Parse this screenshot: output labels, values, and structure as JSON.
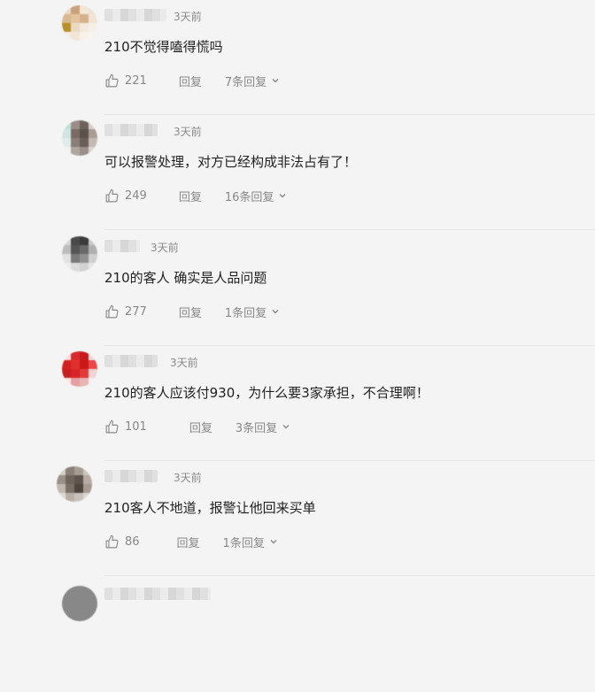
{
  "comments": [
    {
      "time": "3天前",
      "text": "210不觉得嗑得慌吗",
      "likes": "221",
      "reply_label": "回复",
      "replies": "7条回复",
      "avatar_colors": [
        "#e8d9c8",
        "#c9a27a",
        "#f2e6d6",
        "#efe3d3",
        "#d8b890",
        "#e4c49e",
        "#d6b08a",
        "#f0e4d4",
        "#b8902a",
        "#eadac4",
        "#f3e9dc",
        "#f6efe6",
        "#f5ede3",
        "#f1e5d6",
        "#f7f1e9",
        "#f9f5ef"
      ]
    },
    {
      "time": "3天前",
      "text": "可以报警处理，对方已经构成非法占有了！",
      "likes": "249",
      "reply_label": "回复",
      "replies": "16条回复",
      "avatar_colors": [
        "#bfe0da",
        "#9a8e88",
        "#6e625c",
        "#d8d0cc",
        "#cfe6e2",
        "#7a6c64",
        "#5c524c",
        "#a89c94",
        "#e0ecea",
        "#8a7e78",
        "#6a5e58",
        "#c4bab4",
        "#eef2f1",
        "#b0a6a0",
        "#9a9089",
        "#dcd6d2"
      ]
    },
    {
      "time": "3天前",
      "text": "210的客人 确实是人品问题",
      "likes": "277",
      "reply_label": "回复",
      "replies": "1条回复",
      "avatar_colors": [
        "#d8d8d8",
        "#4a4a4a",
        "#3a3a3a",
        "#c9c9c9",
        "#bdbdbd",
        "#555555",
        "#6a6a6a",
        "#b0b0b0",
        "#e2e2e2",
        "#7a7a7a",
        "#909090",
        "#cfcfcf",
        "#ececec",
        "#dcdcdc",
        "#d2d2d2",
        "#e6e6e6"
      ]
    },
    {
      "time": "3天前",
      "text": "210的客人应该付930，为什么要3家承担，不合理啊！",
      "likes": "101",
      "reply_label": "回复",
      "replies": "3条回复",
      "avatar_colors": [
        "#f4e0e0",
        "#d82a2a",
        "#c81c1c",
        "#f2dada",
        "#d42020",
        "#e03030",
        "#cc1818",
        "#e84848",
        "#c82020",
        "#d42626",
        "#e03a3a",
        "#f0d4d4",
        "#f6e6e6",
        "#e4a0a0",
        "#e8b4b4",
        "#f8eeee"
      ]
    },
    {
      "time": "3天前",
      "text": "210客人不地道，报警让他回来买单",
      "likes": "86",
      "reply_label": "回复",
      "replies": "1条回复",
      "avatar_colors": [
        "#d4cec8",
        "#8a8078",
        "#a69c92",
        "#cdc6be",
        "#9a9088",
        "#6e645c",
        "#5e544c",
        "#b6aca2",
        "#c0b8b0",
        "#7a7068",
        "#4e463e",
        "#a49a90",
        "#e0dad4",
        "#b8b0a8",
        "#cac2ba",
        "#ddd7d1"
      ]
    }
  ]
}
